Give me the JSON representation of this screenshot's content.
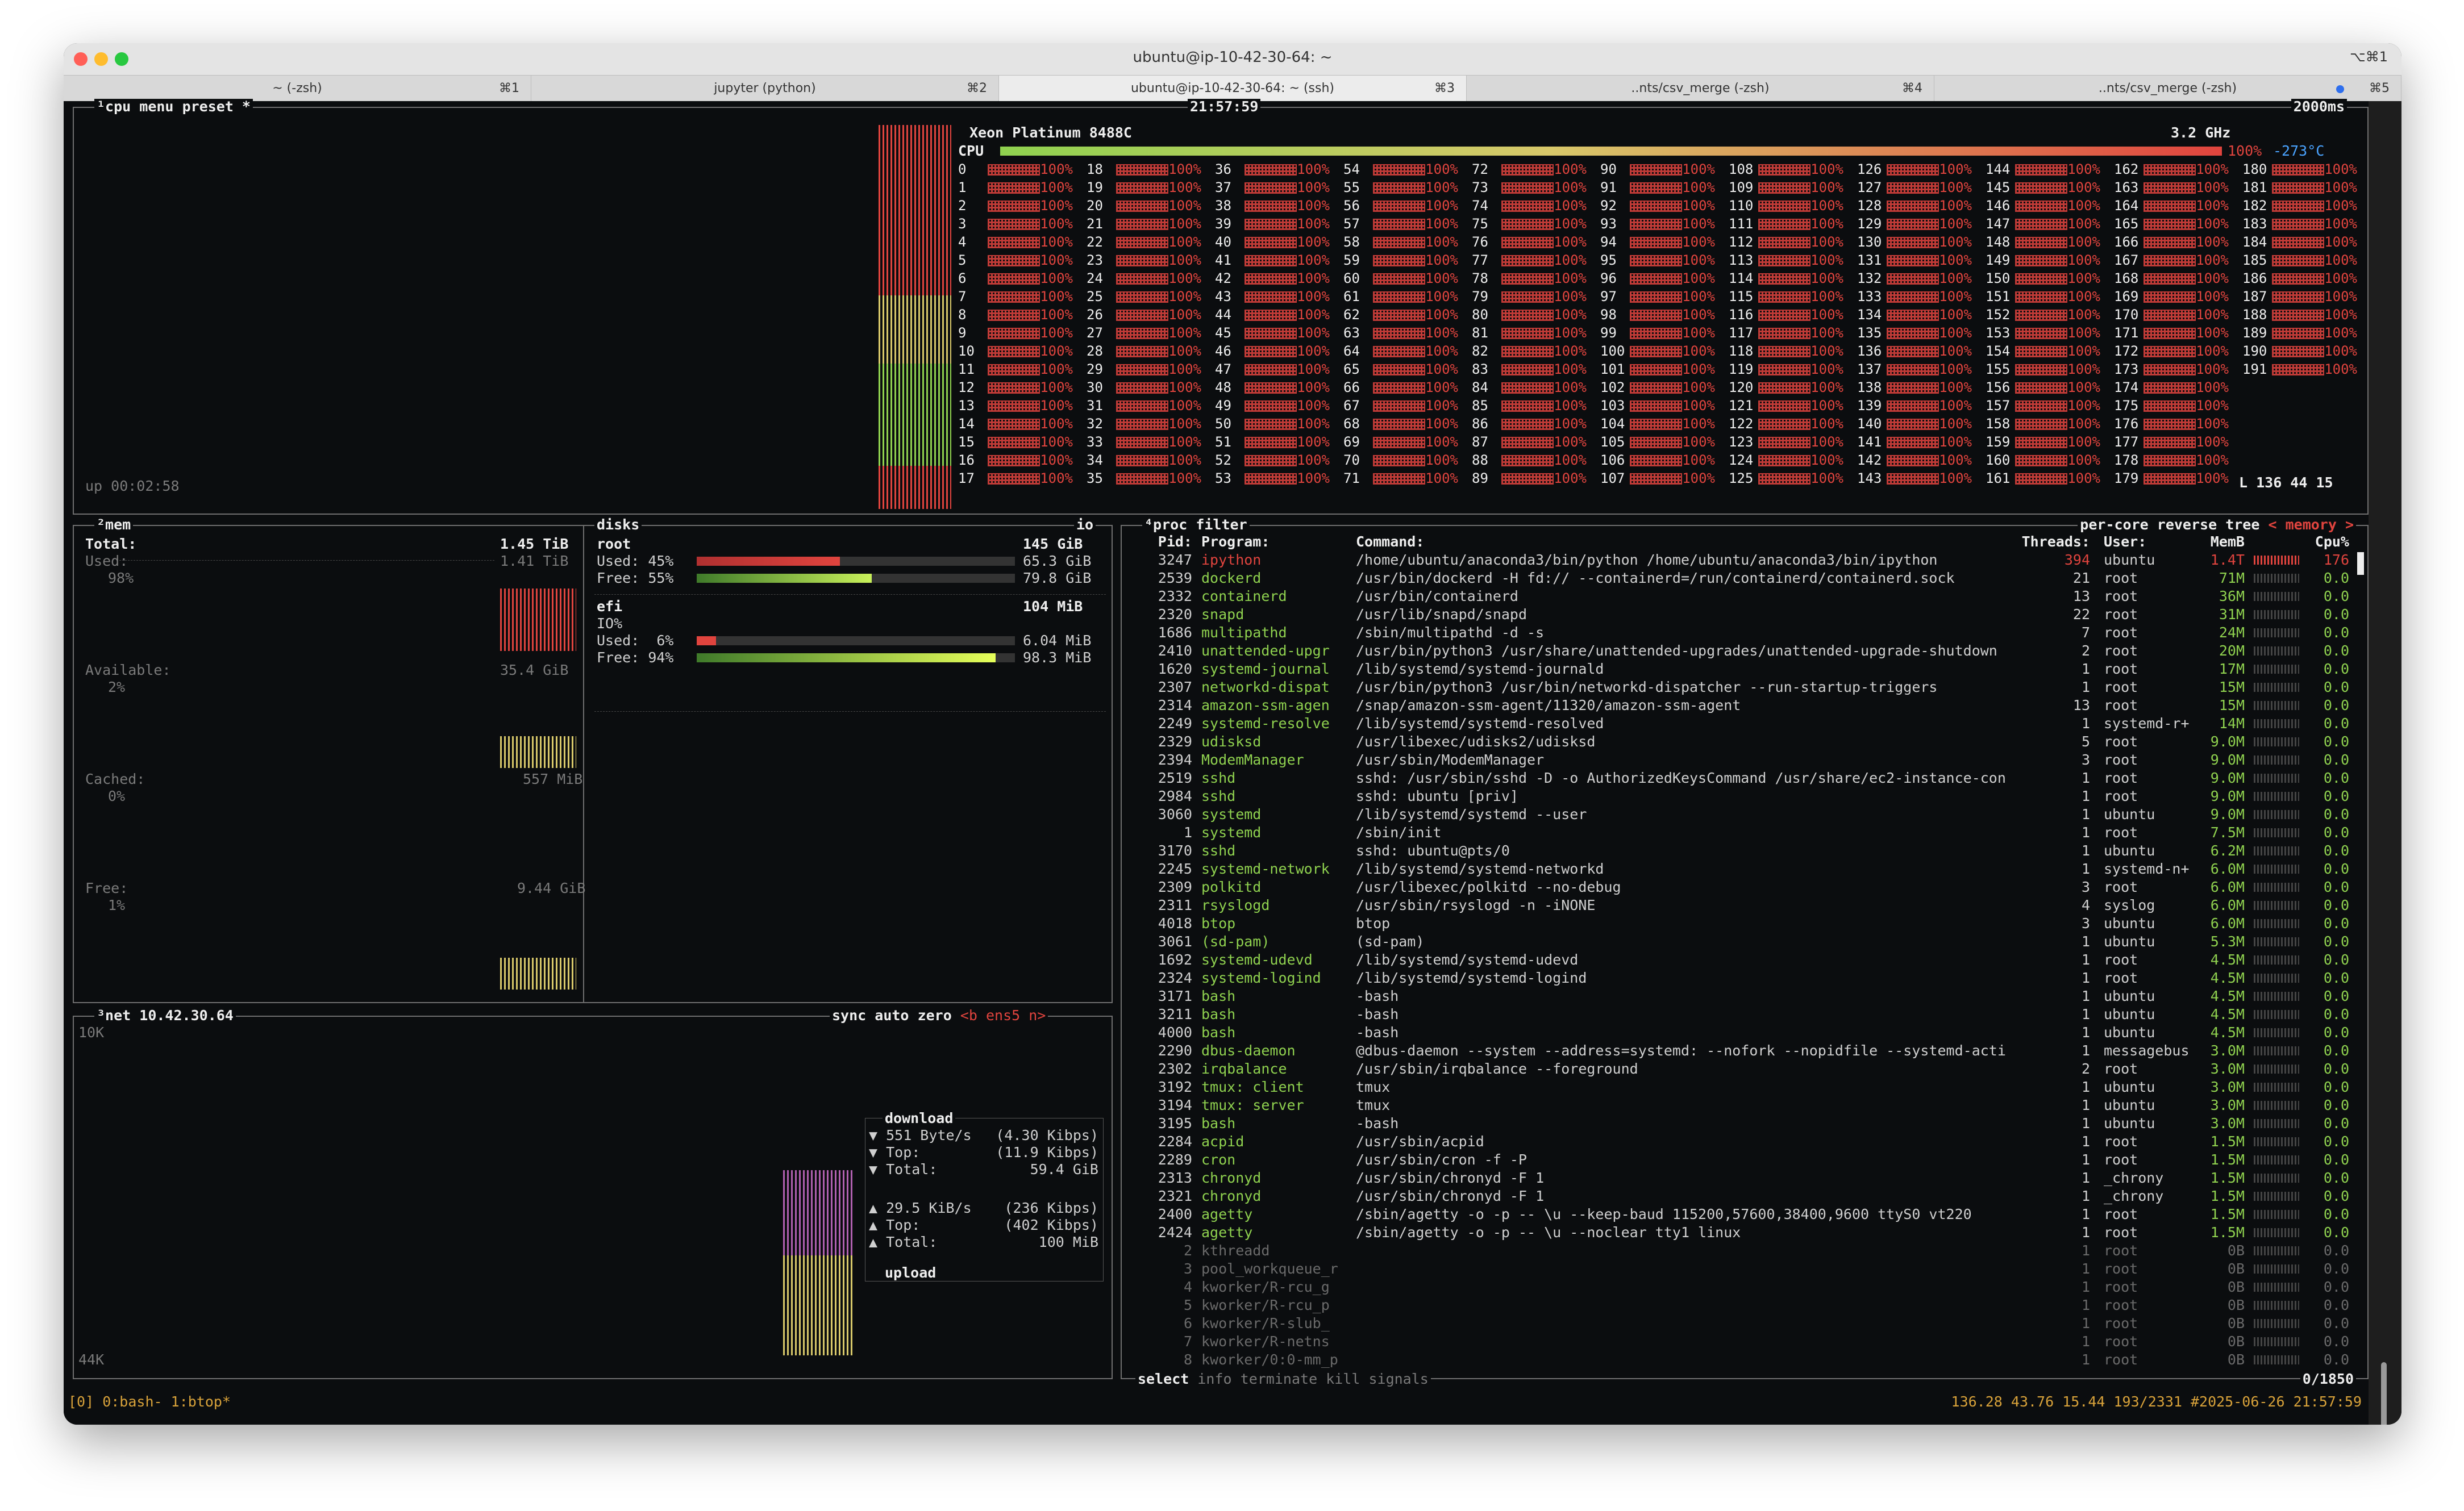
{
  "window": {
    "title": "ubuntu@ip-10-42-30-64: ~",
    "shortcut": "⌥⌘1",
    "tabs": [
      {
        "label": "~ (-zsh)",
        "key": "⌘1"
      },
      {
        "label": "jupyter (python)",
        "key": "⌘2"
      },
      {
        "label": "ubuntu@ip-10-42-30-64: ~ (ssh)",
        "key": "⌘3"
      },
      {
        "label": "..nts/csv_merge (-zsh)",
        "key": "⌘4"
      },
      {
        "label": "..nts/csv_merge (-zsh)",
        "key": "⌘5"
      }
    ]
  },
  "cpu": {
    "menu": [
      "¹cpu",
      "menu",
      "preset *"
    ],
    "clock": "21:57:59",
    "interval": "2000ms",
    "model": "Xeon Platinum 8488C",
    "label": "CPU",
    "total_pct": "100%",
    "freq": "3.2 GHz",
    "temp": "-273°C",
    "uptime": "up 00:02:58",
    "load": "L 136 44 15",
    "core_pct": "100%",
    "core_count": 192,
    "total_fraction": 1.0
  },
  "mem": {
    "title": "²mem",
    "total_label": "Total:",
    "total": "1.45 TiB",
    "used_label": "Used:",
    "used": "1.41 TiB",
    "used_pct": "98%",
    "available_label": "Available:",
    "available": "35.4 GiB",
    "available_pct": "2%",
    "cached_label": "Cached:",
    "cached": "557 MiB",
    "cached_pct": "0%",
    "free_label": "Free:",
    "free": "9.44 GiB",
    "free_pct": "1%"
  },
  "disks": {
    "title": "disks",
    "io": "io",
    "items": [
      {
        "name": "root",
        "size": "145 GiB",
        "used_label": "Used:",
        "used_pct": "45%",
        "used": "65.3 GiB",
        "used_frac": 0.45,
        "free_label": "Free:",
        "free_pct": "55%",
        "free": "79.8 GiB",
        "free_frac": 0.55
      },
      {
        "name": "efi",
        "size": "104 MiB",
        "io_label": "IO%",
        "used_label": "Used:",
        "used_pct": "6%",
        "used": "6.04 MiB",
        "used_frac": 0.06,
        "free_label": "Free:",
        "free_pct": "94%",
        "free": "98.3 MiB",
        "free_frac": 0.94
      }
    ]
  },
  "net": {
    "title": "³net",
    "ip": "10.42.30.64",
    "opts": [
      "sync",
      "auto",
      "zero",
      "<b ens5 n>"
    ],
    "scale_top": "10K",
    "scale_bottom": "44K",
    "download_label": "download",
    "download": [
      {
        "k": "▼ 551 Byte/s",
        "v": "(4.30 Kibps)"
      },
      {
        "k": "▼ Top:",
        "v": "(11.9 Kibps)"
      },
      {
        "k": "▼ Total:",
        "v": "59.4 GiB"
      }
    ],
    "upload": [
      {
        "k": "▲ 29.5 KiB/s",
        "v": "(236 Kibps)"
      },
      {
        "k": "▲ Top:",
        "v": "(402 Kibps)"
      },
      {
        "k": "▲ Total:",
        "v": "100 MiB"
      }
    ],
    "upload_label": "upload"
  },
  "proc": {
    "title": "⁴proc",
    "filter": "filter",
    "opts": [
      "per-core",
      "reverse",
      "tree",
      "< memory >"
    ],
    "headers": {
      "pid": "Pid:",
      "program": "Program:",
      "command": "Command:",
      "threads": "Threads:",
      "user": "User:",
      "mem": "MemB",
      "cpu": "Cpu%"
    },
    "rows": [
      [
        "3247",
        "ipython",
        "/home/ubuntu/anaconda3/bin/python /home/ubuntu/anaconda3/bin/ipython",
        "394",
        "ubuntu",
        "1.4T",
        "176"
      ],
      [
        "2539",
        "dockerd",
        "/usr/bin/dockerd -H fd:// --containerd=/run/containerd/containerd.sock",
        "21",
        "root",
        "71M",
        "0.0"
      ],
      [
        "2332",
        "containerd",
        "/usr/bin/containerd",
        "13",
        "root",
        "36M",
        "0.0"
      ],
      [
        "2320",
        "snapd",
        "/usr/lib/snapd/snapd",
        "22",
        "root",
        "31M",
        "0.0"
      ],
      [
        "1686",
        "multipathd",
        "/sbin/multipathd -d -s",
        "7",
        "root",
        "24M",
        "0.0"
      ],
      [
        "2410",
        "unattended-upgr",
        "/usr/bin/python3 /usr/share/unattended-upgrades/unattended-upgrade-shutdown",
        "2",
        "root",
        "20M",
        "0.0"
      ],
      [
        "1620",
        "systemd-journal",
        "/lib/systemd/systemd-journald",
        "1",
        "root",
        "17M",
        "0.0"
      ],
      [
        "2307",
        "networkd-dispat",
        "/usr/bin/python3 /usr/bin/networkd-dispatcher --run-startup-triggers",
        "1",
        "root",
        "15M",
        "0.0"
      ],
      [
        "2314",
        "amazon-ssm-agen",
        "/snap/amazon-ssm-agent/11320/amazon-ssm-agent",
        "13",
        "root",
        "15M",
        "0.0"
      ],
      [
        "2249",
        "systemd-resolve",
        "/lib/systemd/systemd-resolved",
        "1",
        "systemd-r+",
        "14M",
        "0.0"
      ],
      [
        "2329",
        "udisksd",
        "/usr/libexec/udisks2/udisksd",
        "5",
        "root",
        "9.0M",
        "0.0"
      ],
      [
        "2394",
        "ModemManager",
        "/usr/sbin/ModemManager",
        "3",
        "root",
        "9.0M",
        "0.0"
      ],
      [
        "2519",
        "sshd",
        "sshd: /usr/sbin/sshd -D -o AuthorizedKeysCommand /usr/share/ec2-instance-con",
        "1",
        "root",
        "9.0M",
        "0.0"
      ],
      [
        "2984",
        "sshd",
        "sshd: ubuntu [priv]",
        "1",
        "root",
        "9.0M",
        "0.0"
      ],
      [
        "3060",
        "systemd",
        "/lib/systemd/systemd --user",
        "1",
        "ubuntu",
        "9.0M",
        "0.0"
      ],
      [
        "1",
        "systemd",
        "/sbin/init",
        "1",
        "root",
        "7.5M",
        "0.0"
      ],
      [
        "3170",
        "sshd",
        "sshd: ubuntu@pts/0",
        "1",
        "ubuntu",
        "6.2M",
        "0.0"
      ],
      [
        "2245",
        "systemd-network",
        "/lib/systemd/systemd-networkd",
        "1",
        "systemd-n+",
        "6.0M",
        "0.0"
      ],
      [
        "2309",
        "polkitd",
        "/usr/libexec/polkitd --no-debug",
        "3",
        "root",
        "6.0M",
        "0.0"
      ],
      [
        "2311",
        "rsyslogd",
        "/usr/sbin/rsyslogd -n -iNONE",
        "4",
        "syslog",
        "6.0M",
        "0.0"
      ],
      [
        "4018",
        "btop",
        "btop",
        "3",
        "ubuntu",
        "6.0M",
        "0.0"
      ],
      [
        "3061",
        "(sd-pam)",
        "(sd-pam)",
        "1",
        "ubuntu",
        "5.3M",
        "0.0"
      ],
      [
        "1692",
        "systemd-udevd",
        "/lib/systemd/systemd-udevd",
        "1",
        "root",
        "4.5M",
        "0.0"
      ],
      [
        "2324",
        "systemd-logind",
        "/lib/systemd/systemd-logind",
        "1",
        "root",
        "4.5M",
        "0.0"
      ],
      [
        "3171",
        "bash",
        "-bash",
        "1",
        "ubuntu",
        "4.5M",
        "0.0"
      ],
      [
        "3211",
        "bash",
        "-bash",
        "1",
        "ubuntu",
        "4.5M",
        "0.0"
      ],
      [
        "4000",
        "bash",
        "-bash",
        "1",
        "ubuntu",
        "4.5M",
        "0.0"
      ],
      [
        "2290",
        "dbus-daemon",
        "@dbus-daemon --system --address=systemd: --nofork --nopidfile --systemd-acti",
        "1",
        "messagebus",
        "3.0M",
        "0.0"
      ],
      [
        "2302",
        "irqbalance",
        "/usr/sbin/irqbalance --foreground",
        "2",
        "root",
        "3.0M",
        "0.0"
      ],
      [
        "3192",
        "tmux: client",
        "tmux",
        "1",
        "ubuntu",
        "3.0M",
        "0.0"
      ],
      [
        "3194",
        "tmux: server",
        "tmux",
        "1",
        "ubuntu",
        "3.0M",
        "0.0"
      ],
      [
        "3195",
        "bash",
        "-bash",
        "1",
        "ubuntu",
        "3.0M",
        "0.0"
      ],
      [
        "2284",
        "acpid",
        "/usr/sbin/acpid",
        "1",
        "root",
        "1.5M",
        "0.0"
      ],
      [
        "2289",
        "cron",
        "/usr/sbin/cron -f -P",
        "1",
        "root",
        "1.5M",
        "0.0"
      ],
      [
        "2313",
        "chronyd",
        "/usr/sbin/chronyd -F 1",
        "1",
        "_chrony",
        "1.5M",
        "0.0"
      ],
      [
        "2321",
        "chronyd",
        "/usr/sbin/chronyd -F 1",
        "1",
        "_chrony",
        "1.5M",
        "0.0"
      ],
      [
        "2400",
        "agetty",
        "/sbin/agetty -o -p -- \\u --keep-baud 115200,57600,38400,9600 ttyS0 vt220",
        "1",
        "root",
        "1.5M",
        "0.0"
      ],
      [
        "2424",
        "agetty",
        "/sbin/agetty -o -p -- \\u --noclear tty1 linux",
        "1",
        "root",
        "1.5M",
        "0.0"
      ],
      [
        "2",
        "kthreadd",
        "",
        "1",
        "root",
        "0B",
        "0.0"
      ],
      [
        "3",
        "pool_workqueue_r",
        "",
        "1",
        "root",
        "0B",
        "0.0"
      ],
      [
        "4",
        "kworker/R-rcu_g",
        "",
        "1",
        "root",
        "0B",
        "0.0"
      ],
      [
        "5",
        "kworker/R-rcu_p",
        "",
        "1",
        "root",
        "0B",
        "0.0"
      ],
      [
        "6",
        "kworker/R-slub_",
        "",
        "1",
        "root",
        "0B",
        "0.0"
      ],
      [
        "7",
        "kworker/R-netns",
        "",
        "1",
        "root",
        "0B",
        "0.0"
      ],
      [
        "8",
        "kworker/0:0-mm_p",
        "",
        "1",
        "root",
        "0B",
        "0.0"
      ]
    ],
    "footer": [
      "select",
      "info",
      "terminate",
      "kill",
      "signals"
    ],
    "count": "0/1850"
  },
  "tmux": {
    "left": "[0] 0:bash- 1:btop*",
    "right": "136.28 43.76 15.44 193/2331 #2025-06-26 21:57:59"
  },
  "colors": {
    "accent_red": "#e0443e",
    "green": "#8fd14f",
    "border": "#6e6e6e",
    "text": "#cfcfcf"
  }
}
